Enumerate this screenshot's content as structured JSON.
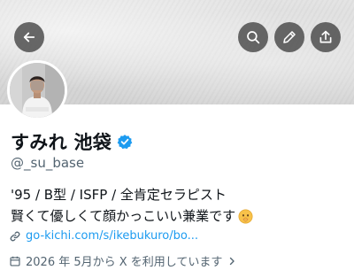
{
  "profile": {
    "display_name": "すみれ 池袋",
    "handle": "@_su_base",
    "bio_lines": [
      "'95 / B型 / ISFP / 全肯定セラピスト",
      "賢くて優しくて顔かっこいい兼業です"
    ],
    "bio_emoji": "hushed-face-emoji",
    "link": "go-kichi.com/s/ikebukuro/bo...",
    "joined": "2026 年 5月から X を利用しています"
  },
  "header_buttons": {
    "back": "arrow-left-icon",
    "search": "search-icon",
    "edit": "pencil-icon",
    "share": "share-icon"
  },
  "colors": {
    "accent": "#1d9bf0",
    "text_secondary": "#536471",
    "button_bg": "#404040"
  }
}
